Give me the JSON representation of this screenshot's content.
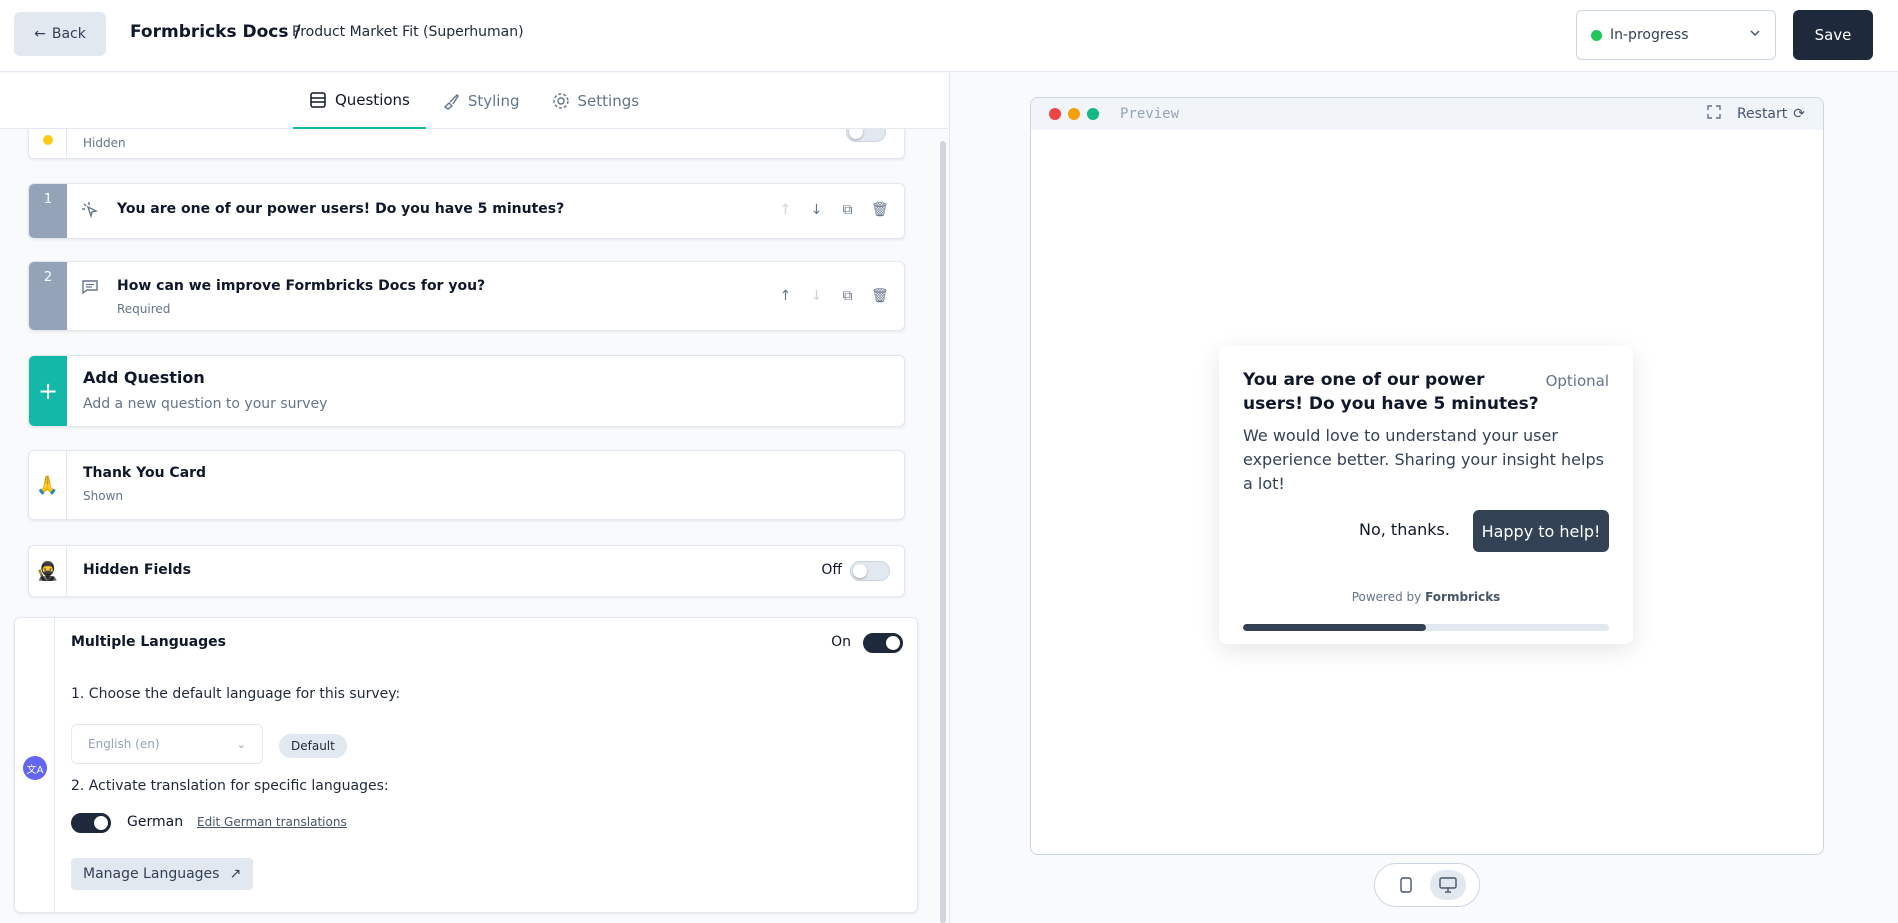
{
  "header": {
    "back_label": "Back",
    "workspace": "Formbricks Docs /",
    "survey_name": "Product Market Fit (Superhuman)",
    "status": "In-progress",
    "status_color": "#22c55e",
    "save_label": "Save"
  },
  "tabs": [
    {
      "label": "Questions",
      "icon": "list-icon",
      "active": true
    },
    {
      "label": "Styling",
      "icon": "paintbrush-icon",
      "active": false
    },
    {
      "label": "Settings",
      "icon": "gear-icon",
      "active": false
    }
  ],
  "welcome": {
    "sub": "Hidden"
  },
  "questions": [
    {
      "number": "1",
      "icon": "cursor-click-icon",
      "title": "You are one of our power users! Do you have 5 minutes?",
      "sub": ""
    },
    {
      "number": "2",
      "icon": "message-icon",
      "title": "How can we improve Formbricks Docs for you?",
      "sub": "Required"
    }
  ],
  "add_question": {
    "title": "Add Question",
    "sub": "Add a new question to your survey"
  },
  "thank_you": {
    "emoji": "🙏",
    "title": "Thank You Card",
    "sub": "Shown"
  },
  "hidden_fields": {
    "emoji": "🥷",
    "title": "Hidden Fields",
    "state": "Off"
  },
  "languages": {
    "title": "Multiple Languages",
    "state": "On",
    "step1": "1. Choose the default language for this survey:",
    "default_lang": "English (en)",
    "default_pill": "Default",
    "step2": "2. Activate translation for specific languages:",
    "lang_name": "German",
    "edit_link": "Edit German translations",
    "manage_label": "Manage Languages"
  },
  "preview": {
    "label": "Preview",
    "restart_label": "Restart",
    "card": {
      "title": "You are one of our power users! Do you have 5 minutes?",
      "optional": "Optional",
      "body": "We would love to understand your user experience better. Sharing your insight helps a lot!",
      "decline": "No, thanks.",
      "accept": "Happy to help!",
      "powered_prefix": "Powered by",
      "powered_brand": "Formbricks",
      "progress": 0.5
    }
  }
}
